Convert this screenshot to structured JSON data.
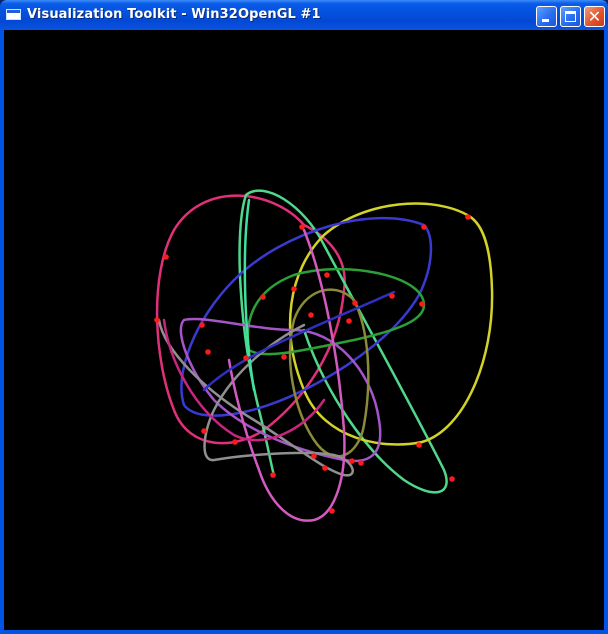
{
  "window": {
    "title": "Visualization Toolkit - Win32OpenGL #1",
    "controls": {
      "minimize_icon": "minimize-icon",
      "maximize_icon": "maximize-icon",
      "close_icon": "close-icon"
    }
  },
  "scene": {
    "background": "#000000",
    "point_color": "#ff1a1a",
    "curves": [
      {
        "color": "#c8267e"
      },
      {
        "color": "#4fd88a"
      },
      {
        "color": "#d3d228"
      },
      {
        "color": "#3a3ad0"
      },
      {
        "color": "#2aa036"
      },
      {
        "color": "#a455c8"
      },
      {
        "color": "#8a8a3a"
      },
      {
        "color": "#909090"
      },
      {
        "color": "#d45ac0"
      },
      {
        "color": "#40e0a0"
      },
      {
        "color": "#e0307a"
      },
      {
        "color": "#3030c0"
      }
    ]
  }
}
